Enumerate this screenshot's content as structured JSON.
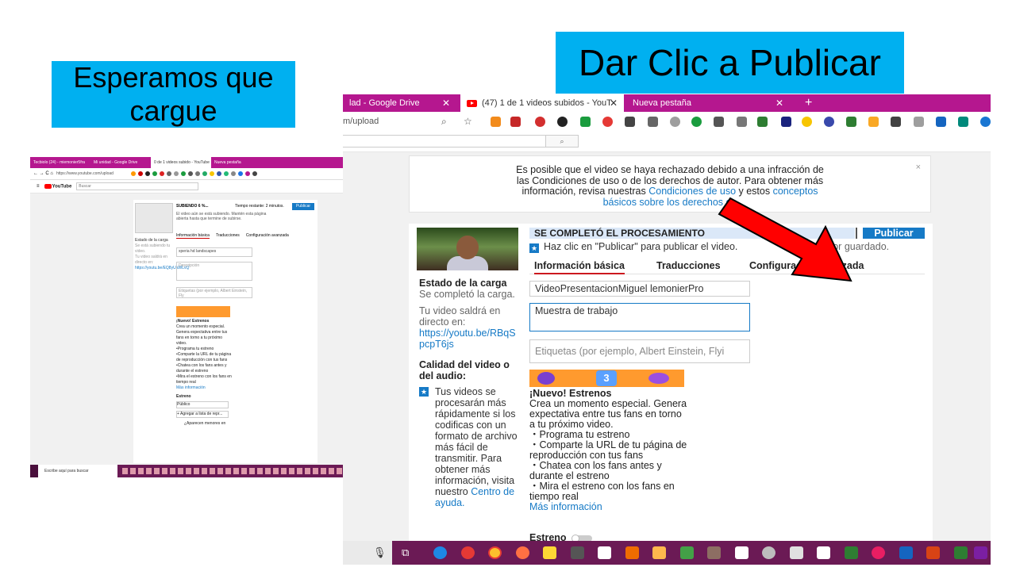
{
  "captions": {
    "left_line1": "Esperamos que",
    "left_line2": "cargue",
    "right": "Dar Clic a Publicar"
  },
  "small_screenshot": {
    "tabs": [
      "Tecbiolo (24) - miemonier5fra",
      "Mi unidad - Google Drive",
      "0 de 1 videos subido - YouTube",
      "Nueva pestaña"
    ],
    "url": "https://www.youtube.com/upload",
    "search_placeholder": "Buscar",
    "status": "SUBIENDO 6 %...",
    "time_left": "Tiempo restante: 2 minutos.",
    "publish": "Publicar",
    "message": "El video aún se está subiendo. Mantén esta página abierta hasta que termine de subirse.",
    "tabs_content": [
      "Información básica",
      "Traducciones",
      "Configuración avanzada"
    ],
    "left_title": "Estado de la carga",
    "left_status": "Se está subiendo tu video.",
    "left_live": "Tu video saldrá en directo en:",
    "left_link": "https://youtu.be/EQ8yUaWLvQ",
    "title_value": "xperia hd landscapes",
    "desc_placeholder": "Descripción",
    "tags_placeholder": "Etiquetas (por ejemplo, Albert Einstein, Fly",
    "new_title": "¡Nuevo! Estrenos",
    "new_body": "Crea un momento especial. Genera expectativa entre tus fans en torno a tu próximo video.",
    "bullets": [
      "•Programa tu estreno",
      "•Comparte la URL de tu página de reproducción con tus fans",
      "•Chatea con los fans antes y durante el estreno",
      "•Mira el estreno con los fans en tiempo real"
    ],
    "more": "Más información",
    "estreno": "Estreno",
    "visibility": "Público",
    "add_list": "+ Agregar a lista de repr...",
    "aparecen": "¿Aparecen menores en",
    "taskbar_search": "Escribe aquí para buscar"
  },
  "large_screenshot": {
    "tabs": [
      {
        "label": "lad - Google Drive",
        "close": "✕"
      },
      {
        "label": "(47) 1 de 1 videos subidos - YouT",
        "close": "✕"
      },
      {
        "label": "Nueva pestaña",
        "close": "✕"
      }
    ],
    "new_tab": "+",
    "url": "m/upload",
    "notice": {
      "text1": "Es posible que el video se haya rechazado debido a una infracción de",
      "text2": "las Condiciones de uso o de los derechos de autor. Para obtener más",
      "text3a": "información, revisa nuestras ",
      "link1": "Condiciones de uso",
      "text3b": " y estos ",
      "link2a": "conceptos",
      "link2b": "básicos sobre los derechos de",
      "close": "×"
    },
    "processing": "SE COMPLETÓ EL PROCESAMIENTO",
    "publish": "Publicar",
    "hint": "Haz clic en \"Publicar\" para publicar el video.",
    "draft": "rrador guardado.",
    "tabs_content": [
      "Información básica",
      "Traducciones",
      "Configuración avanzada"
    ],
    "left": {
      "title": "Estado de la carga",
      "status": "Se completó la carga.",
      "live": "Tu video saldrá en directo en:",
      "link": "https://youtu.be/RBqSpcpT6js",
      "quality_title": "Calidad del video o del audio:",
      "quality_text": "Tus videos se procesarán más rápidamente si los codificas con un formato de archivo más fácil de transmitir. Para obtener más información, visita nuestro",
      "help": "Centro de ayuda."
    },
    "title_value": "VideoPresentacionMiguel lemonierPro",
    "description": "Muestra de trabajo",
    "tags_placeholder": "Etiquetas (por ejemplo, Albert Einstein, Flyi",
    "premiere_number": "3",
    "new_title": "¡Nuevo! Estrenos",
    "new_body": "Crea un momento especial. Genera expectativa entre tus fans en torno a tu próximo video.",
    "bullets": [
      "・Programa tu estreno",
      "・Comparte la URL de tu página de reproducción con tus fans",
      "・Chatea con los fans antes y durante el estreno",
      "・Mira el estreno con los fans en tiempo real"
    ],
    "more": "Más información",
    "estreno": "Estreno"
  },
  "colors": {
    "caption_bg": "#00b0f0",
    "tabbar": "#b5178f",
    "taskbar": "#6b1a55",
    "link": "#167ac6",
    "arrow": "#ff0000"
  }
}
